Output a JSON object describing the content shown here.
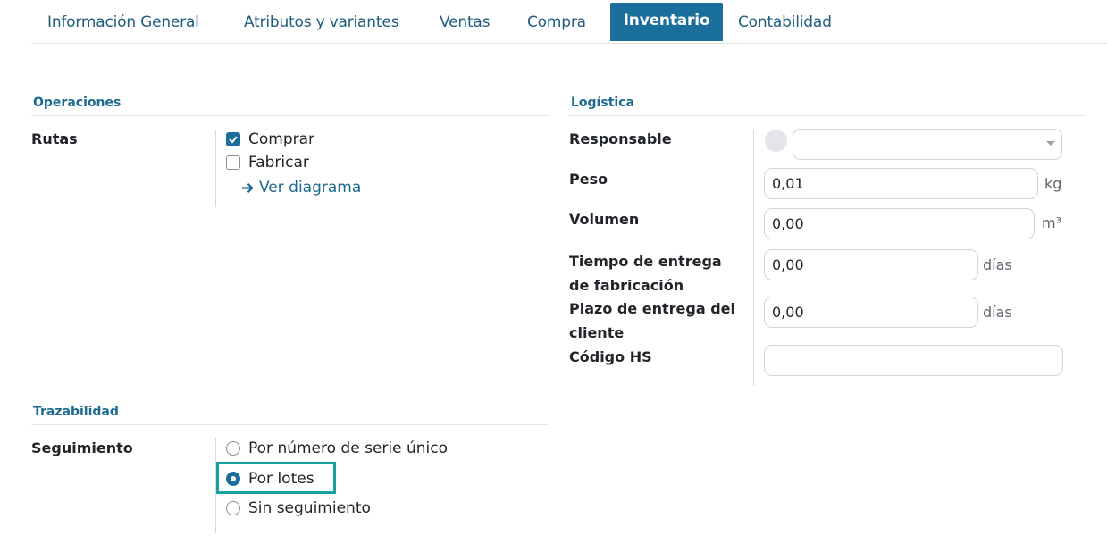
{
  "tabs": [
    {
      "label": "Información General"
    },
    {
      "label": "Atributos y variantes"
    },
    {
      "label": "Ventas"
    },
    {
      "label": "Compra"
    },
    {
      "label": "Inventario",
      "active": true
    },
    {
      "label": "Contabilidad"
    }
  ],
  "operaciones": {
    "title": "Operaciones",
    "rutas_label": "Rutas",
    "routes": [
      {
        "label": "Comprar",
        "checked": true
      },
      {
        "label": "Fabricar",
        "checked": false
      }
    ],
    "diagram_link": "Ver diagrama"
  },
  "logistica": {
    "title": "Logística",
    "responsable_label": "Responsable",
    "responsable_value": "",
    "peso_label": "Peso",
    "peso_value": "0,01",
    "peso_unit": "kg",
    "volumen_label": "Volumen",
    "volumen_value": "0,00",
    "volumen_unit": "m³",
    "tiempo_label_1": "Tiempo de entrega",
    "tiempo_label_2": "de fabricación",
    "tiempo_value": "0,00",
    "tiempo_unit": "días",
    "plazo_label_1": "Plazo de entrega del",
    "plazo_label_2": "cliente",
    "plazo_value": "0,00",
    "plazo_unit": "días",
    "hs_label": "Código HS",
    "hs_value": ""
  },
  "trazabilidad": {
    "title": "Trazabilidad",
    "seguimiento_label": "Seguimiento",
    "options": [
      {
        "label": "Por número de serie único",
        "selected": false
      },
      {
        "label": "Por lotes",
        "selected": true
      },
      {
        "label": "Sin seguimiento",
        "selected": false
      }
    ]
  },
  "colors": {
    "accent": "#1b6f9c",
    "highlight": "#17a2a0"
  }
}
